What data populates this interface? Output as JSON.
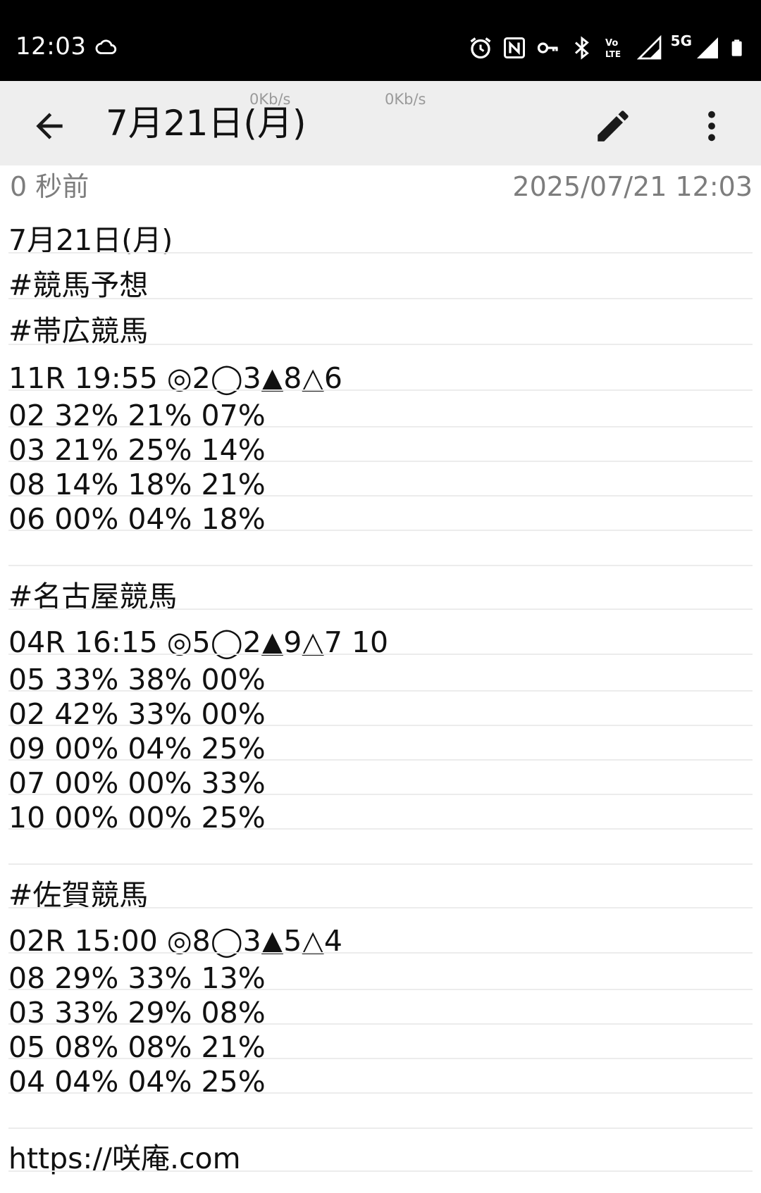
{
  "status_bar": {
    "time": "12:03",
    "left_icon": "cloud-icon",
    "icons": [
      "alarm-icon",
      "nfc-icon",
      "vpn-key-icon",
      "bluetooth-icon",
      "volte-icon",
      "signal-icon",
      "signal-5g-icon",
      "battery-icon"
    ],
    "network_label": "5G",
    "volte_label_top": "Vo",
    "volte_label_bottom": "LTE"
  },
  "toolbar": {
    "title": "7月21日(月)",
    "net_speed_1": "0Kb/s",
    "net_speed_2": "0Kb/s",
    "back_icon": "arrow-back-icon",
    "edit_icon": "pencil-icon",
    "more_icon": "more-vert-icon"
  },
  "meta": {
    "relative_time": "0 秒前",
    "timestamp": "2025/07/21 12:03"
  },
  "note": {
    "lines": [
      "7月21日(月)",
      "#競馬予想",
      "#帯広競馬",
      "11R 19:55 ◎2◯3▲8△6",
      "02 32% 21% 07%",
      "03 21% 25% 14%",
      "08 14% 18% 21%",
      "06 00% 04% 18%",
      "",
      "#名古屋競馬",
      "04R 16:15 ◎5◯2▲9△7 10",
      "05 33% 38% 00%",
      "02 42% 33% 00%",
      "09 00% 04% 25%",
      "07 00% 00% 33%",
      "10 00% 00% 25%",
      "",
      "#佐賀競馬",
      "02R 15:00 ◎8◯3▲5△4",
      "08 29% 33% 13%",
      "03 33% 29% 08%",
      "05 08% 08% 21%",
      "04 04% 04% 25%",
      "",
      "https://咲庵.com"
    ]
  }
}
